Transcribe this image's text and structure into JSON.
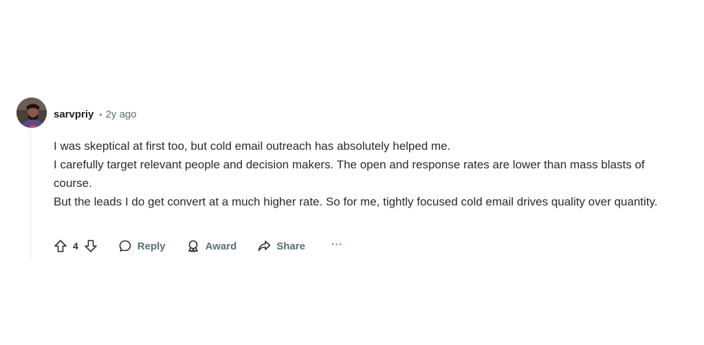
{
  "comment": {
    "username": "sarvpriy",
    "separator": "•",
    "timestamp": "2y ago",
    "avatar_icon": "user-avatar",
    "body_lines": [
      "I was skeptical at first too, but cold email outreach has absolutely helped me.",
      "I carefully target relevant people and decision makers. The open and response rates are lower than mass blasts of course.",
      "But the leads I do get convert at a much higher rate. So for me, tightly focused cold email drives quality over quantity."
    ],
    "actions": {
      "upvote_icon": "upvote-arrow-icon",
      "vote_count": "4",
      "downvote_icon": "downvote-arrow-icon",
      "reply_label": "Reply",
      "award_label": "Award",
      "share_label": "Share",
      "more_label": "···"
    }
  }
}
